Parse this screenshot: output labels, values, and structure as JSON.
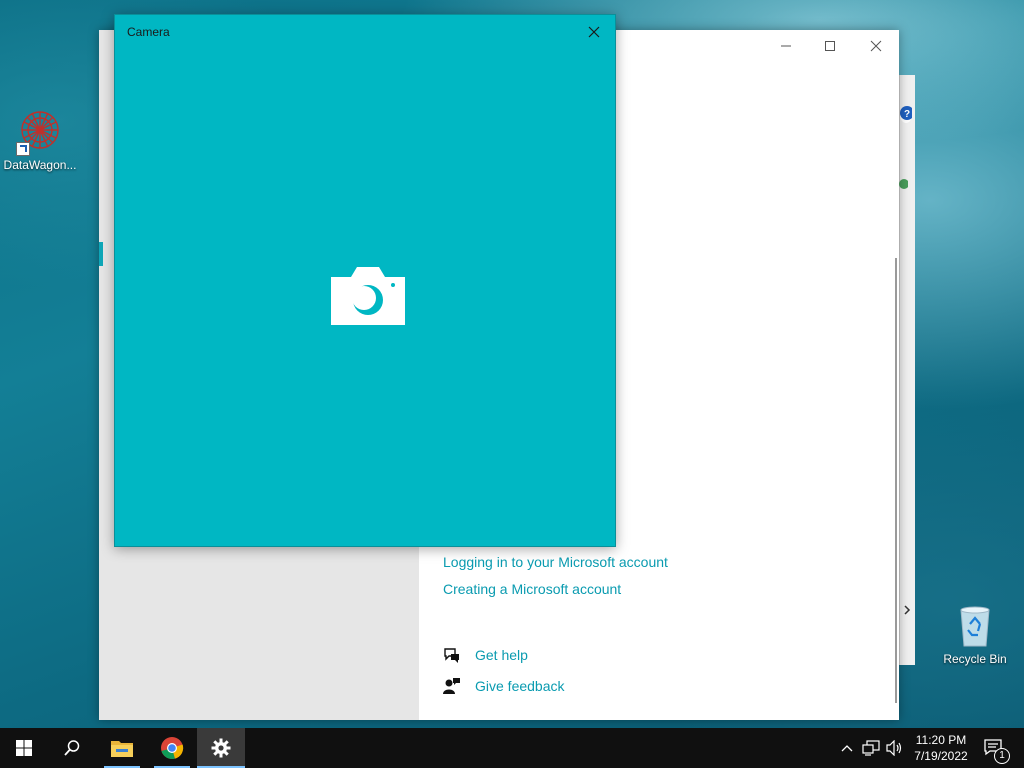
{
  "desktop": {
    "icons": [
      {
        "label": "DataWagon..."
      },
      {
        "label": "Recycle Bin"
      }
    ]
  },
  "settings_window": {
    "links": [
      {
        "label": "Logging in to your Microsoft account"
      },
      {
        "label": "Creating a Microsoft account"
      }
    ],
    "help": {
      "label": "Get help"
    },
    "feedback": {
      "label": "Give feedback"
    }
  },
  "camera_window": {
    "title": "Camera",
    "background_color": "#00b7c3"
  },
  "taskbar": {
    "time": "11:20 PM",
    "date": "7/19/2022",
    "notification_count": "1"
  }
}
